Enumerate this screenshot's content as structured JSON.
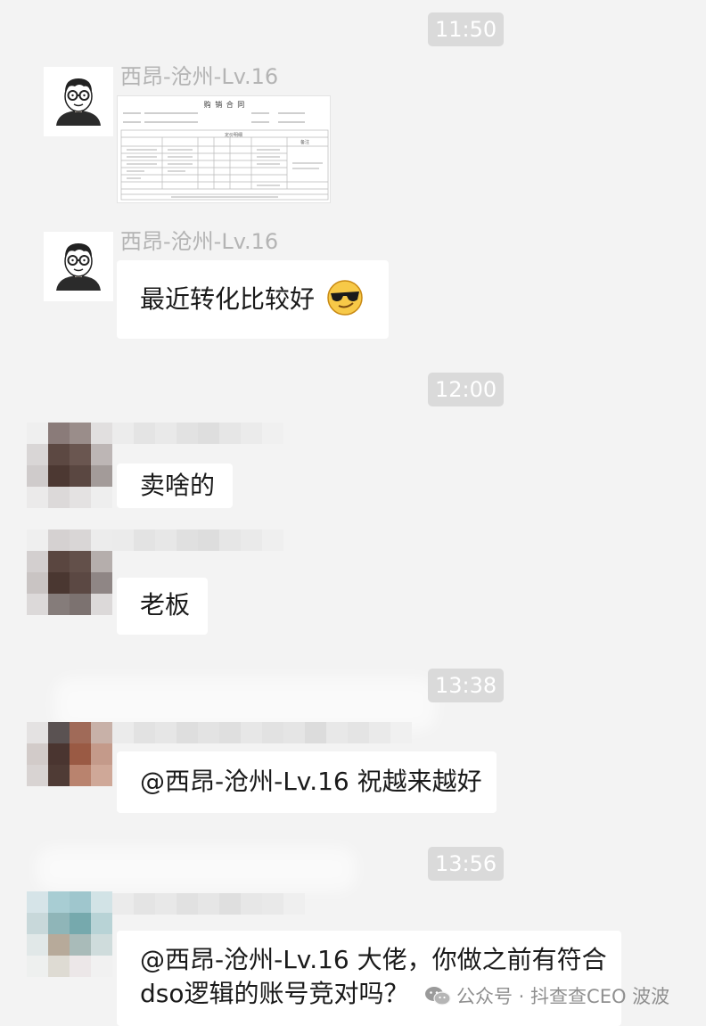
{
  "messages": {
    "t1": "11:50",
    "m1_sender": "西昂-沧州-Lv.16",
    "doc": {
      "title": "购 销 合 同",
      "subtitle": "定价明细",
      "note": "备注"
    },
    "m2_sender": "西昂-沧州-Lv.16",
    "m2_text": "最近转化比较好",
    "t2": "12:00",
    "m3_text": "卖啥的",
    "m4_text": "老板",
    "t3": "13:38",
    "m5_text": "@西昂-沧州-Lv.16 祝越来越好",
    "t4": "13:56",
    "m6_line1": "@西昂-沧州-Lv.16 大佬，你做之前有符合",
    "m6_line2": "dso逻辑的账号竞对吗？"
  },
  "watermark": {
    "text": "公众号 · 抖查查CEO 波波",
    "icon": "wechat-icon"
  },
  "colors": {
    "background": "#f3f3f3",
    "bubble": "#ffffff",
    "timestamp_bg": "#dadada",
    "sender_name": "#b4b4b4"
  }
}
